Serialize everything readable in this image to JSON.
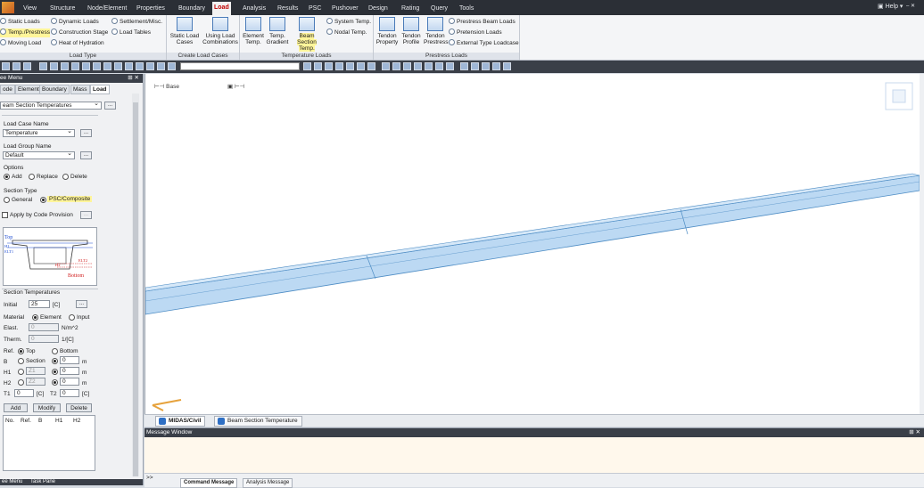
{
  "menu": {
    "tabs": [
      "View",
      "Structure",
      "Node/Element",
      "Properties",
      "Boundary",
      "Load",
      "Analysis",
      "Results",
      "PSC",
      "Pushover",
      "Design",
      "Rating",
      "Query",
      "Tools"
    ],
    "active": "Load",
    "help": "Help"
  },
  "ribbon": {
    "load_type": {
      "title": "Load Type",
      "items": [
        "Static Loads",
        "Temp./Prestress",
        "Moving Load",
        "Dynamic Loads",
        "Construction Stage",
        "Heat of Hydration",
        "Settlement/Misc.",
        "Load Tables"
      ]
    },
    "create_load_cases": {
      "title": "Create Load Cases",
      "static_load_cases": "Static Load Cases",
      "using_load_combinations": "Using Load Combinations"
    },
    "temperature_loads": {
      "title": "Temperature Loads",
      "element_temp": "Element Temp.",
      "temp_gradient": "Temp. Gradient",
      "beam_section_temp": "Beam Section Temp.",
      "system_temp": "System Temp.",
      "nodal_temp": "Nodal Temp."
    },
    "prestress_loads": {
      "title": "Prestress Loads",
      "tendon_property": "Tendon Property",
      "tendon_profile": "Tendon Profile",
      "tendon_prestress": "Tendon Prestress",
      "prestress_beam_loads": "Prestress Beam Loads",
      "pretension_loads": "Pretension Loads",
      "external_type_loadcase": "External Type Loadcase"
    }
  },
  "panel": {
    "title": "ee Menu",
    "tabs": [
      "ode",
      "Element",
      "Boundary",
      "Mass",
      "Load"
    ],
    "active_tab": "Load",
    "command": "eam Section Temperatures",
    "load_case_name_label": "Load Case Name",
    "load_case_name": "Temperature",
    "load_group_name_label": "Load Group Name",
    "load_group_name": "Default",
    "options_label": "Options",
    "options": [
      "Add",
      "Replace",
      "Delete"
    ],
    "option_selected": "Add",
    "section_type_label": "Section Type",
    "section_types": [
      "General",
      "PSC/Composite"
    ],
    "section_type_selected": "PSC/Composite",
    "apply_by_code_label": "Apply by Code Provision",
    "diagram": {
      "top": "Top",
      "bottom": "Bottom",
      "h1": "H1",
      "h2": "H2",
      "b": "B",
      "t1": "T1",
      "t2": "T2",
      "elt1": "ELT1",
      "elt2": "ELT2"
    },
    "section_temps_label": "Section Temperatures",
    "initial_label": "Initial",
    "initial_value": "25",
    "initial_unit": "[C]",
    "material_label": "Material",
    "material_options": [
      "Element",
      "Input"
    ],
    "material_selected": "Element",
    "elast_label": "Elast.",
    "elast_value": "0",
    "elast_unit": "N/m^2",
    "therm_label": "Therm.",
    "therm_value": "0",
    "therm_unit": "1/[C]",
    "ref_label": "Ref.",
    "ref_options": [
      "Top",
      "Bottom"
    ],
    "ref_selected": "Top",
    "b_label": "B",
    "b_section": "Section",
    "b_value": "0",
    "b_unit": "m",
    "h1_label": "H1",
    "h1_z": "Z1",
    "h1_value": "0",
    "h1_unit": "m",
    "h2_label": "H2",
    "h2_z": "Z2",
    "h2_value": "0",
    "h2_unit": "m",
    "t1_label": "T1",
    "t1_value": "0",
    "t1_unit": "[C]",
    "t2_label": "T2",
    "t2_value": "0",
    "t2_unit": "[C]",
    "add": "Add",
    "modify": "Modify",
    "delete": "Delete",
    "table_headers": [
      "No.",
      "Ref.",
      "B",
      "H1",
      "H2"
    ],
    "bottom_tabs": [
      "ee Menu",
      "Task Pane"
    ]
  },
  "viewport": {
    "label": "Base",
    "tabs": [
      "MIDAS/Civil",
      "Beam Section Temperature"
    ],
    "active_tab": "MIDAS/Civil"
  },
  "message_window": {
    "title": "Message Window",
    "prompt": ">>",
    "tabs": [
      "Command Message",
      "Analysis Message"
    ]
  },
  "colors": {
    "menubar": "#2b2f36",
    "highlight": "#fff59a",
    "beam": "#bcd9f3",
    "beam_edge": "#4d8cc4"
  }
}
